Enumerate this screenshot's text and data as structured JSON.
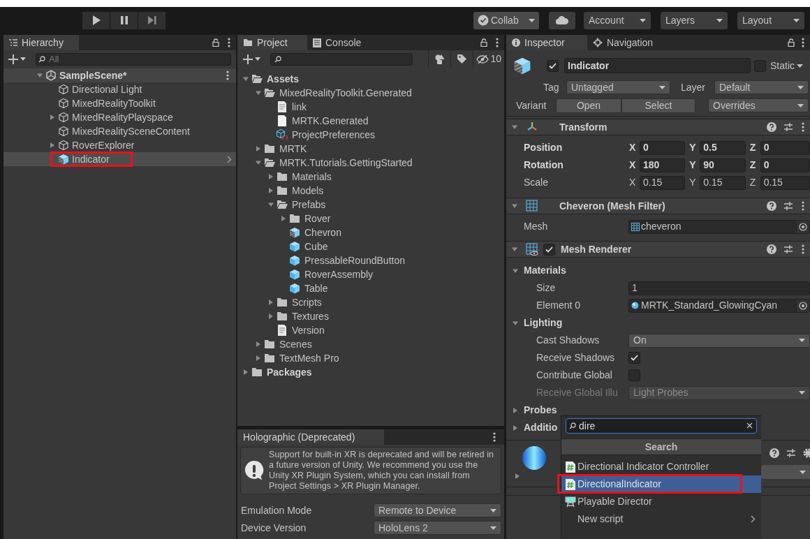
{
  "toolbar": {
    "play_buttons": [
      {
        "kind": "play"
      },
      {
        "kind": "pause"
      },
      {
        "kind": "step"
      }
    ],
    "buttons": [
      {
        "kind": "collab",
        "label": "Collab"
      },
      {
        "kind": "cloud"
      },
      {
        "kind": "dropdown",
        "label": "Account"
      },
      {
        "kind": "dropdown",
        "label": "Layers"
      },
      {
        "kind": "dropdown",
        "label": "Layout"
      }
    ]
  },
  "hierarchy": {
    "tab": "Hierarchy",
    "search_placeholder": "All",
    "scene": {
      "label": "SampleScene*",
      "expanded": true
    },
    "items": [
      {
        "label": "Directional Light",
        "kind": "object",
        "has_children": false,
        "selected": false,
        "annotated": false
      },
      {
        "label": "MixedRealityToolkit",
        "kind": "object",
        "has_children": false,
        "selected": false,
        "annotated": false
      },
      {
        "label": "MixedRealityPlayspace",
        "kind": "object",
        "has_children": true,
        "selected": false,
        "annotated": false
      },
      {
        "label": "MixedRealitySceneContent",
        "kind": "object",
        "has_children": false,
        "selected": false,
        "annotated": false
      },
      {
        "label": "RoverExplorer",
        "kind": "object",
        "has_children": true,
        "selected": false,
        "annotated": false
      },
      {
        "label": "Indicator",
        "kind": "prefab-variant",
        "has_children": false,
        "selected": true,
        "annotated": true
      }
    ]
  },
  "project": {
    "tabs": [
      {
        "label": "Project",
        "kind": "folder",
        "selected": true
      },
      {
        "label": "Console",
        "kind": "console",
        "selected": false
      }
    ],
    "hidden_count": "10",
    "tree": [
      {
        "label": "Assets",
        "kind": "folder",
        "expanded": true,
        "children": [
          {
            "label": "MixedRealityToolkit.Generated",
            "kind": "folder",
            "expanded": true,
            "children": [
              {
                "label": "link",
                "kind": "text-file"
              },
              {
                "label": "MRTK.Generated",
                "kind": "blank-file"
              },
              {
                "label": "ProjectPreferences",
                "kind": "asset-file"
              }
            ]
          },
          {
            "label": "MRTK",
            "kind": "folder",
            "expanded": false
          },
          {
            "label": "MRTK.Tutorials.GettingStarted",
            "kind": "folder",
            "expanded": true,
            "children": [
              {
                "label": "Materials",
                "kind": "folder",
                "expanded": false
              },
              {
                "label": "Models",
                "kind": "folder",
                "expanded": false
              },
              {
                "label": "Prefabs",
                "kind": "folder",
                "expanded": true,
                "children": [
                  {
                    "label": "Rover",
                    "kind": "folder",
                    "expanded": false
                  },
                  {
                    "label": "Chevron",
                    "kind": "prefab-variant"
                  },
                  {
                    "label": "Cube",
                    "kind": "prefab"
                  },
                  {
                    "label": "PressableRoundButton",
                    "kind": "prefab"
                  },
                  {
                    "label": "RoverAssembly",
                    "kind": "prefab"
                  },
                  {
                    "label": "Table",
                    "kind": "prefab"
                  }
                ]
              },
              {
                "label": "Scripts",
                "kind": "folder",
                "expanded": false
              },
              {
                "label": "Textures",
                "kind": "folder",
                "expanded": false
              },
              {
                "label": "Version",
                "kind": "text-file"
              }
            ]
          },
          {
            "label": "Scenes",
            "kind": "folder",
            "expanded": false
          },
          {
            "label": "TextMesh Pro",
            "kind": "folder",
            "expanded": false
          }
        ]
      },
      {
        "label": "Packages",
        "kind": "folder",
        "expanded": false
      }
    ]
  },
  "holographic": {
    "tab": "Holographic (Deprecated)",
    "message": "Support for built-in XR is deprecated and will be retired in a future version of Unity. We recommend you use the Unity XR Plugin System, which you can install from Project Settings > XR Plugin Manager.",
    "fields": [
      {
        "label": "Emulation Mode",
        "value": "Remote to Device"
      },
      {
        "label": "Device Version",
        "value": "HoloLens 2"
      }
    ]
  },
  "inspector": {
    "tabs": [
      {
        "label": "Inspector",
        "kind": "info",
        "selected": true
      },
      {
        "label": "Navigation",
        "kind": "navigation",
        "selected": false
      }
    ],
    "object": {
      "active": true,
      "name": "Indicator",
      "static": false,
      "static_label": "Static",
      "tag_label": "Tag",
      "tag": "Untagged",
      "layer_label": "Layer",
      "layer": "Default",
      "variant_label": "Variant",
      "variant_buttons": [
        "Open",
        "Select"
      ],
      "overrides": "Overrides"
    },
    "transform": {
      "title": "Transform",
      "expanded": true,
      "rows": [
        {
          "label": "Position",
          "overridden": true,
          "values": [
            {
              "axis": "X",
              "value": "0"
            },
            {
              "axis": "Y",
              "value": "0.5"
            },
            {
              "axis": "Z",
              "value": "0"
            }
          ]
        },
        {
          "label": "Rotation",
          "overridden": true,
          "values": [
            {
              "axis": "X",
              "value": "180"
            },
            {
              "axis": "Y",
              "value": "90"
            },
            {
              "axis": "Z",
              "value": "0"
            }
          ]
        },
        {
          "label": "Scale",
          "overridden": false,
          "values": [
            {
              "axis": "X",
              "value": "0.15"
            },
            {
              "axis": "Y",
              "value": "0.15"
            },
            {
              "axis": "Z",
              "value": "0.15"
            }
          ]
        }
      ]
    },
    "mesh_filter": {
      "title": "Cheveron (Mesh Filter)",
      "expanded": true,
      "mesh_label": "Mesh",
      "mesh": "cheveron"
    },
    "mesh_renderer": {
      "title": "Mesh Renderer",
      "expanded": true,
      "enabled": true,
      "sections": [
        {
          "title": "Materials",
          "expanded": true,
          "rows": [
            {
              "kind": "text",
              "label": "Size",
              "value": "1"
            },
            {
              "kind": "object",
              "label": "Element 0",
              "value": "MRTK_Standard_GlowingCyan"
            }
          ]
        },
        {
          "title": "Lighting",
          "expanded": true,
          "rows": [
            {
              "kind": "dropdown",
              "label": "Cast Shadows",
              "value": "On",
              "disabled": false
            },
            {
              "kind": "checkbox",
              "label": "Receive Shadows",
              "checked": true
            },
            {
              "kind": "checkbox",
              "label": "Contribute Global",
              "checked": false
            },
            {
              "kind": "dropdown",
              "label": "Receive Global Illu",
              "value": "Light Probes",
              "disabled": true
            }
          ]
        },
        {
          "title": "Probes",
          "expanded": false
        },
        {
          "title": "Additio",
          "expanded": false
        }
      ]
    },
    "material": {
      "expanded": false
    }
  },
  "add_component_popup": {
    "search": "dire",
    "header": "Search",
    "items": [
      {
        "label": "Directional Indicator Controller",
        "kind": "script",
        "selected": false,
        "annotated": false
      },
      {
        "label": "DirectionalIndicator",
        "kind": "script",
        "selected": true,
        "annotated": true
      },
      {
        "label": "Playable Director",
        "kind": "director",
        "selected": false,
        "annotated": false
      },
      {
        "label": "New script",
        "kind": "submenu",
        "selected": false,
        "annotated": false
      }
    ]
  }
}
